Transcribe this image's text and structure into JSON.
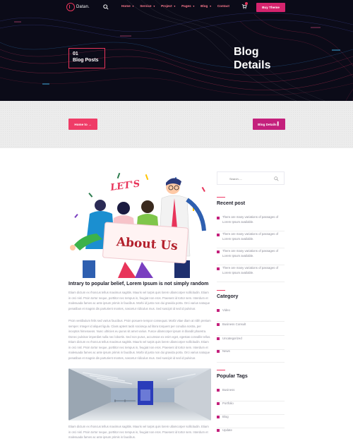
{
  "header": {
    "logo_text": "Datan.",
    "nav": [
      {
        "label": "Home",
        "dropdown": true
      },
      {
        "label": "Service",
        "dropdown": true
      },
      {
        "label": "Project",
        "dropdown": true
      },
      {
        "label": "Pages",
        "dropdown": true
      },
      {
        "label": "Blog",
        "dropdown": true
      },
      {
        "label": "Contact",
        "dropdown": false
      }
    ],
    "cart_count": "",
    "buy_button": "Buy Theme",
    "badge_number": "01",
    "badge_label": "Blog Posts",
    "title_line1": "Blog",
    "title_line2": "Details"
  },
  "breadcrumb": {
    "home_label": "Home to",
    "home_arrow": "→",
    "current_label": "Blog Details"
  },
  "post": {
    "illustration_text_top": "LET'S",
    "illustration_text_sign": "About Us",
    "title": "Intrary to popular belief, Lorem Ipsum is not simply random",
    "paragraph1": "Etiam dictum ex rhoncus tellus maximus sagittis. Mauris vel turpis quis lorem ullamcorper sollicitudin. Etiam in orci nisl. Proin tortor neque, porttitor nec tempus in, feugiat non eros. Praesent id tortor sem. Interdum et malesuada fames ac ante ipsum primis in faucibus. Morbi id justo non dui gravida porta. Orci varius natoque penatibus et magnis dis parturient montes, nascetur ridiculus mus. Sed suscipit id sed id pulvinar.",
    "paragraph2": "Proin vestibulum felis sed varius faucibus. Proin posuere tempor consequat. Morbi vitae diam at nibh pretium semper. Integer id aliquet ligula. Class aptent taciti sociosqu ad litora torquent per conubia nostra, per inceptos himenaeos. Nunc ultricies eu purus sit amet varius. Fusce ullamcorper ipsum in blandit pharetra. Donec pulvinar imperdiet nulla nec lobortis. Sed non purus, accumsan ex enim eget, egestas convallis tellus. Etiam dictum ex rhoncus tellus maximus sagittis. Mauris vel turpis quis lorem ullamcorper sollicitudin. Etiam in orci nisl. Proin tortor neque, porttitor nec tempus in, feugiat non eros. Praesent id tortor sem. Interdum et malesuada fames ac ante ipsum primis in faucibus. Morbi id justo non dui gravida porta. Orci varius natoque penatibus et magnis dis parturient montes, nascetur ridiculus mus. Sed suscipit id sed id pulvinar.",
    "paragraph3": "Etiam dictum ex rhoncus tellus maximus sagittis. Mauris vel turpis quis lorem ullamcorper sollicitudin. Etiam in orci nisl. Proin tortor neque, porttitor nec tempus in, feugiat non eros. Praesent id tortor sem. Interdum et malesuada fames ac ante ipsum primis in faucibus."
  },
  "sidebar": {
    "search_placeholder": "Search.....",
    "recent_heading": "Recent post",
    "recent_posts": [
      "There are many variations of passages of Lorem Ipsum available.",
      "There are many variations of passages of Lorem Ipsum available.",
      "There are many variations of passages of Lorem Ipsum available.",
      "There are many variations of passages of Lorem Ipsum available."
    ],
    "category_heading": "Category",
    "categories": [
      "Video",
      "Business Consult",
      "Uncategorized",
      "News"
    ],
    "tags_heading": "Popular Tags",
    "tags": [
      "Business",
      "Portfolio",
      "Blog",
      "Update"
    ]
  },
  "colors": {
    "accent": "#ef3c67",
    "magenta": "#c4207c",
    "hero_bg": "#0b0b18"
  }
}
